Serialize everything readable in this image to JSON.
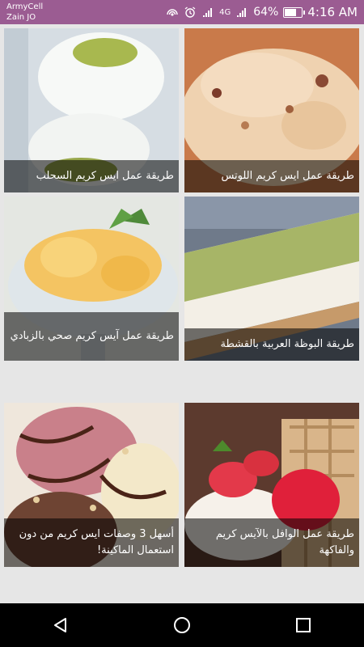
{
  "status_bar": {
    "carrier_line1": "ArmyCell",
    "carrier_line2": "Zain JO",
    "network": "4G",
    "battery": "64%",
    "time": "4:16 AM",
    "background": "#9b5c92"
  },
  "cards": [
    {
      "title": "طريقة عمل ايس كريم اللوتس",
      "image": "lotus-ice-cream-photo"
    },
    {
      "title": "طريقة عمل ايس كريم السحلب",
      "image": "sahlab-ice-cream-photo"
    },
    {
      "title": "طريقة البوظة العربية بالقشطة",
      "image": "arabic-booza-photo"
    },
    {
      "title": "طريقة عمل آيس كريم صحي بالزبادي",
      "image": "yogurt-ice-cream-photo"
    },
    {
      "title": "طريقة عمل الوافل بالآيس كريم والفاكهة",
      "image": "waffle-ice-cream-photo"
    },
    {
      "title": "أسهل 3 وصفات ايس كريم من دون استعمال الماكينة!",
      "image": "three-ice-creams-photo"
    }
  ],
  "nav_bar": {
    "back": "back-icon",
    "home": "home-icon",
    "recents": "recents-icon"
  }
}
